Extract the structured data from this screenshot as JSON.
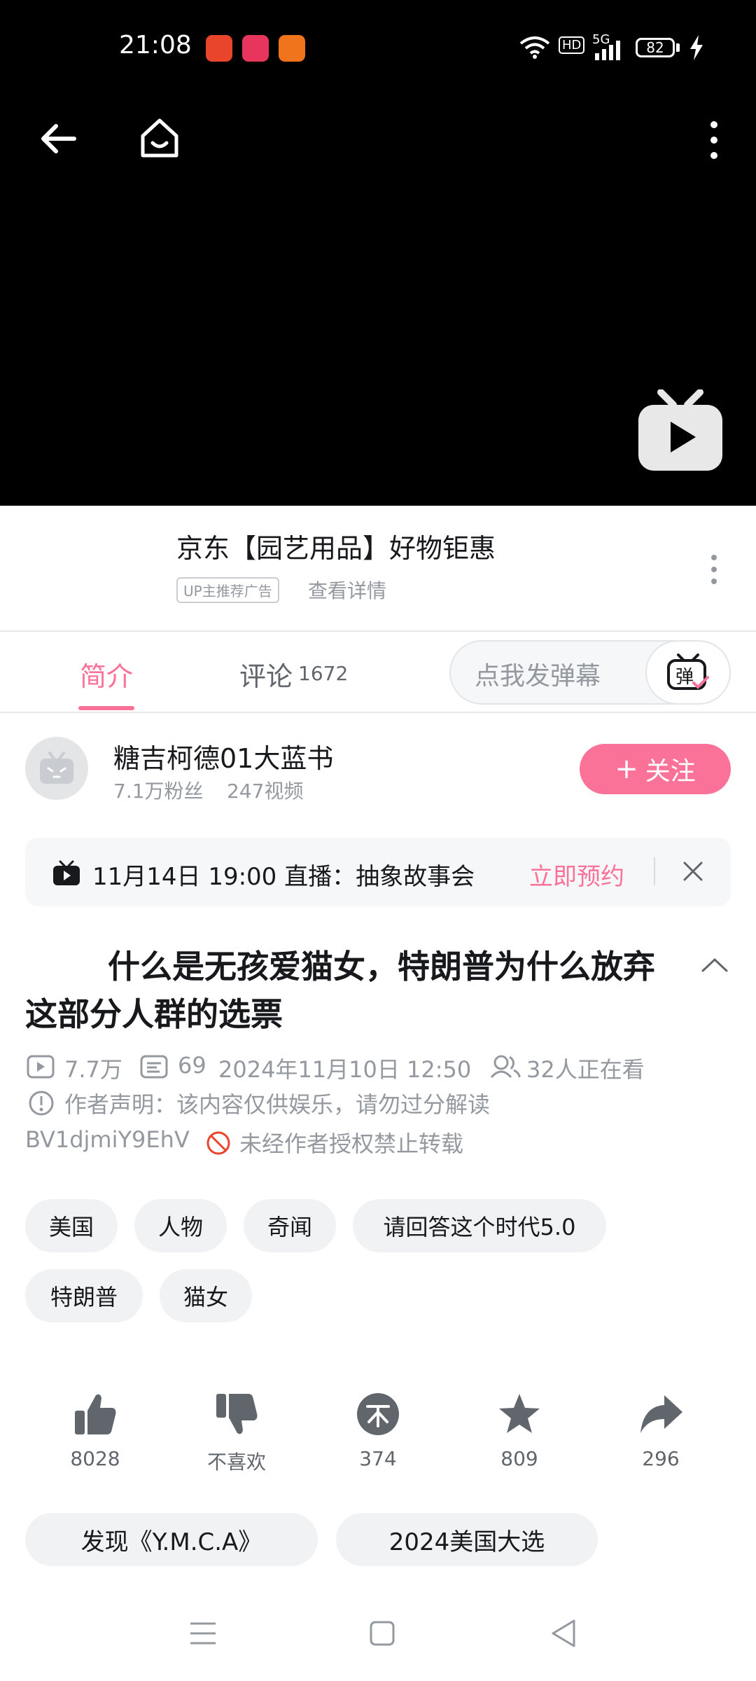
{
  "status_bar": {
    "time": "21:08",
    "network": "5G",
    "hd": "HD",
    "battery": "82"
  },
  "ad": {
    "title": "京东【园艺用品】好物钜惠",
    "badge": "UP主推荐广告",
    "detail": "查看详情"
  },
  "tabs": {
    "intro": "简介",
    "comments": "评论",
    "comment_count": "1672",
    "danmaku_placeholder": "点我发弹幕",
    "danmaku_btn": "弹"
  },
  "uploader": {
    "name": "糖吉柯德01大蓝书",
    "followers": "7.1万粉丝",
    "videos": "247视频",
    "follow_label": "关注"
  },
  "live": {
    "text": "11月14日 19:00 直播：抽象故事会",
    "reserve": "立即预约"
  },
  "video": {
    "title": "什么是无孩爱猫女，特朗普为什么放弃这部分人群的选票",
    "views": "7.7万",
    "danmaku": "69",
    "date": "2024年11月10日 12:50",
    "watching": "32人正在看",
    "notice": "作者声明：该内容仅供娱乐，请勿过分解读",
    "bvid": "BV1djmiY9EhV",
    "no_repost": "未经作者授权禁止转载"
  },
  "tags": [
    "美国",
    "人物",
    "奇闻",
    "请回答这个时代5.0",
    "特朗普",
    "猫女"
  ],
  "actions": {
    "like": "8028",
    "dislike": "不喜欢",
    "coin": "374",
    "favorite": "809",
    "share": "296"
  },
  "chips": [
    "发现《Y.M.C.A》",
    "2024美国大选"
  ],
  "colors": {
    "accent": "#fb7299",
    "muted": "#9499a0"
  }
}
